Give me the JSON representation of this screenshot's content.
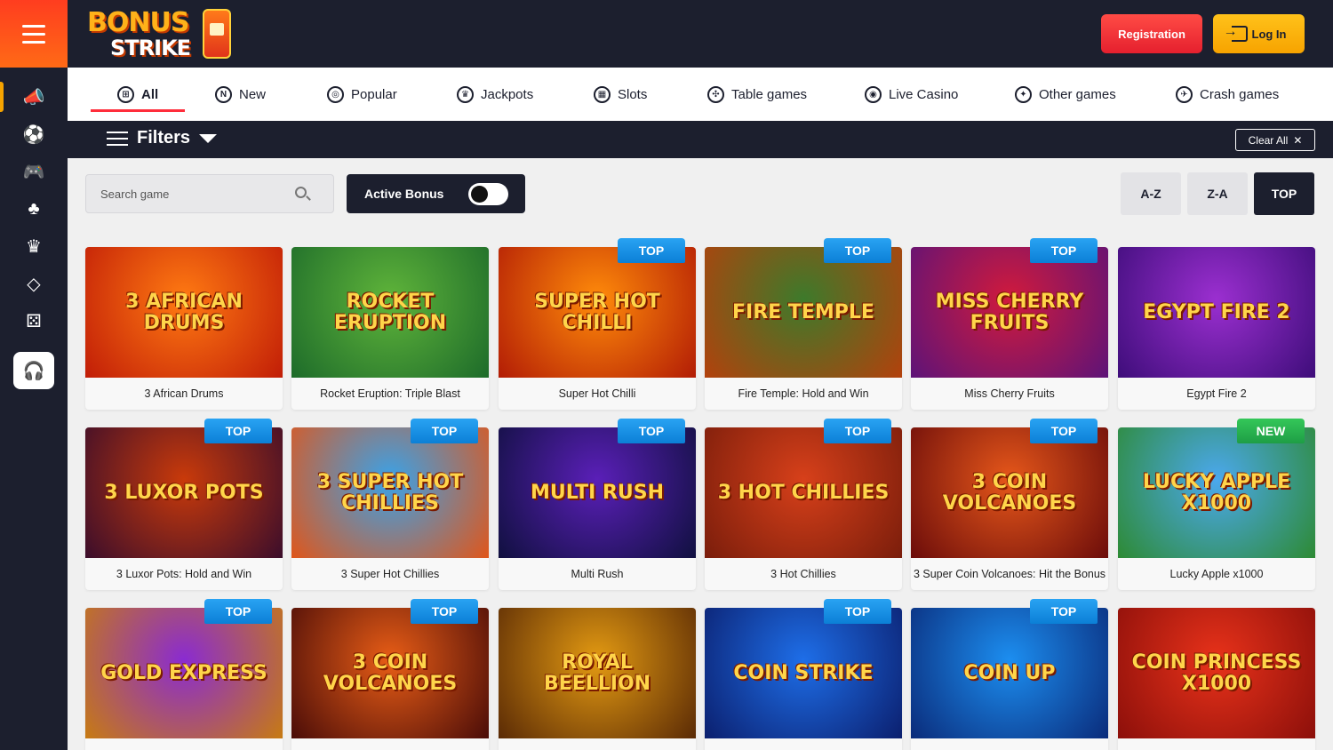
{
  "brand": {
    "line1": "BONUS",
    "line2": "STRIKE"
  },
  "header": {
    "registration": "Registration",
    "login": "Log In"
  },
  "categories": [
    {
      "label": "All",
      "icon": "grid-icon",
      "glyph": "⊞"
    },
    {
      "label": "New",
      "icon": "new-icon",
      "glyph": "N"
    },
    {
      "label": "Popular",
      "icon": "popular-icon",
      "glyph": "◎"
    },
    {
      "label": "Jackpots",
      "icon": "crown-icon",
      "glyph": "♛"
    },
    {
      "label": "Slots",
      "icon": "slots-icon",
      "glyph": "▦"
    },
    {
      "label": "Table games",
      "icon": "table-games-icon",
      "glyph": "✣"
    },
    {
      "label": "Live Casino",
      "icon": "live-casino-icon",
      "glyph": "◉"
    },
    {
      "label": "Other games",
      "icon": "other-games-icon",
      "glyph": "✦"
    },
    {
      "label": "Crash games",
      "icon": "crash-games-icon",
      "glyph": "✈"
    }
  ],
  "filters": {
    "title": "Filters",
    "clear_all": "Clear All",
    "clear_icon": "✕"
  },
  "search": {
    "placeholder": "Search game"
  },
  "active_bonus": {
    "label": "Active Bonus",
    "on": false
  },
  "sort": {
    "az": "A-Z",
    "za": "Z-A",
    "top": "TOP",
    "selected": "TOP"
  },
  "badges": {
    "top": "TOP",
    "new": "NEW"
  },
  "games": [
    {
      "name": "3 African Drums",
      "art": "3 African Drums",
      "badge": "",
      "colors": [
        "#ff7a12",
        "#c11d07"
      ]
    },
    {
      "name": "Rocket Eruption: Triple Blast",
      "art": "Rocket Eruption",
      "badge": "",
      "colors": [
        "#5fb43a",
        "#1d6b2a"
      ]
    },
    {
      "name": "Super Hot Chilli",
      "art": "Super Hot Chilli",
      "badge": "TOP",
      "colors": [
        "#ff8b0a",
        "#b21c05"
      ]
    },
    {
      "name": "Fire Temple: Hold and Win",
      "art": "Fire Temple",
      "badge": "TOP",
      "colors": [
        "#3d7a2b",
        "#b3410c"
      ]
    },
    {
      "name": "Miss Cherry Fruits",
      "art": "Miss Cherry Fruits",
      "badge": "TOP",
      "colors": [
        "#d11a3c",
        "#5d1378"
      ]
    },
    {
      "name": "Egypt Fire 2",
      "art": "Egypt Fire 2",
      "badge": "",
      "colors": [
        "#9b2fd0",
        "#3e0d7a"
      ]
    },
    {
      "name": "3 Luxor Pots: Hold and Win",
      "art": "3 Luxor Pots",
      "badge": "TOP",
      "colors": [
        "#c93a0a",
        "#3b0d2b"
      ]
    },
    {
      "name": "3 Super Hot Chillies",
      "art": "3 Super Hot Chillies",
      "badge": "TOP",
      "colors": [
        "#3aa2e8",
        "#e0561a"
      ]
    },
    {
      "name": "Multi Rush",
      "art": "Multi Rush",
      "badge": "TOP",
      "colors": [
        "#5a1fb8",
        "#10103f"
      ]
    },
    {
      "name": "3 Hot Chillies",
      "art": "3 Hot Chillies",
      "badge": "TOP",
      "colors": [
        "#d7401a",
        "#7a1d0b"
      ]
    },
    {
      "name": "3 Super Coin Volcanoes: Hit the Bonus",
      "art": "3 Coin Volcanoes",
      "badge": "TOP",
      "colors": [
        "#e6571a",
        "#6b0c0a"
      ]
    },
    {
      "name": "Lucky Apple x1000",
      "art": "Lucky Apple x1000",
      "badge": "NEW",
      "colors": [
        "#4ba8ee",
        "#2d8a33"
      ]
    },
    {
      "name": "",
      "art": "Gold Express",
      "badge": "TOP",
      "colors": [
        "#8a2bd1",
        "#c77b12"
      ]
    },
    {
      "name": "",
      "art": "3 Coin Volcanoes",
      "badge": "TOP",
      "colors": [
        "#e85d16",
        "#4a0c08"
      ]
    },
    {
      "name": "",
      "art": "Royal Beellion",
      "badge": "",
      "colors": [
        "#e39a12",
        "#5a2a05"
      ]
    },
    {
      "name": "",
      "art": "Coin Strike",
      "badge": "TOP",
      "colors": [
        "#1e6ee8",
        "#0b1f6e"
      ]
    },
    {
      "name": "",
      "art": "Coin Up",
      "badge": "TOP",
      "colors": [
        "#1c8ef0",
        "#0a2b7a"
      ]
    },
    {
      "name": "",
      "art": "Coin Princess x1000",
      "badge": "",
      "colors": [
        "#e8321a",
        "#8c0f0a"
      ]
    }
  ]
}
